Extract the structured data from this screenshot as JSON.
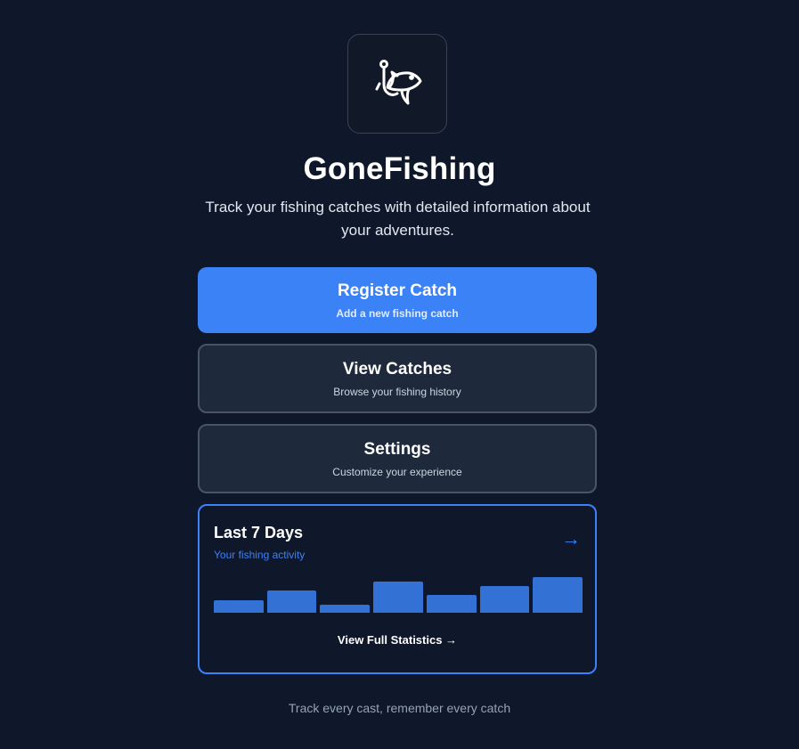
{
  "app": {
    "title": "GoneFishing",
    "tagline": "Track your fishing catches with detailed information about your adventures.",
    "logo_icon": "fish-hook-icon"
  },
  "actions": {
    "register": {
      "title": "Register Catch",
      "subtitle": "Add a new fishing catch"
    },
    "view": {
      "title": "View Catches",
      "subtitle": "Browse your fishing history"
    },
    "settings": {
      "title": "Settings",
      "subtitle": "Customize your experience"
    }
  },
  "stats": {
    "title": "Last 7 Days",
    "subtitle": "Your fishing activity",
    "arrow": "→",
    "link": "View Full Statistics →"
  },
  "chart_data": {
    "type": "bar",
    "values": [
      14,
      25,
      9,
      35,
      20,
      30,
      40
    ],
    "ylim": [
      0,
      42
    ]
  },
  "footer": {
    "text": "Track every cast, remember every catch"
  },
  "colors": {
    "background": "#0f172a",
    "primary": "#3b82f6",
    "card": "#1e293b",
    "bar": "#3471d4"
  }
}
